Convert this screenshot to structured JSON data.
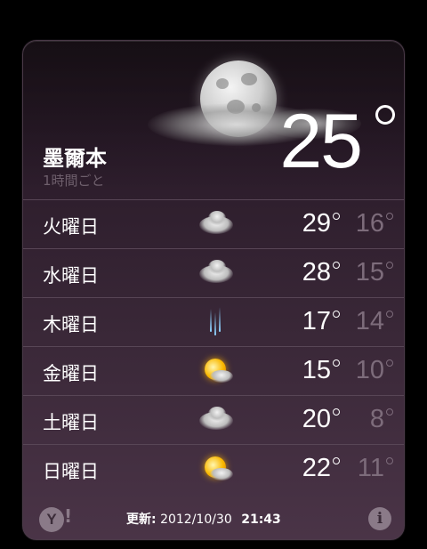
{
  "location": {
    "city": "墨爾本",
    "interval": "1時間ごと"
  },
  "current": {
    "temp": "25"
  },
  "forecast": [
    {
      "day": "火曜日",
      "icon": "partly-cloudy-night-icon",
      "hi": "29",
      "lo": "16"
    },
    {
      "day": "水曜日",
      "icon": "partly-cloudy-night-icon",
      "hi": "28",
      "lo": "15"
    },
    {
      "day": "木曜日",
      "icon": "rain-icon",
      "hi": "17",
      "lo": "14"
    },
    {
      "day": "金曜日",
      "icon": "sun-cloud-icon",
      "hi": "15",
      "lo": "10"
    },
    {
      "day": "土曜日",
      "icon": "partly-cloudy-night-icon",
      "hi": "20",
      "lo": "8"
    },
    {
      "day": "日曜日",
      "icon": "sun-cloud-icon",
      "hi": "22",
      "lo": "11"
    }
  ],
  "footer": {
    "logo": "Y",
    "logo_bang": "!",
    "updated_label": "更新:",
    "updated_date": "2012/10/30",
    "updated_time": "21:43",
    "info_glyph": "i"
  },
  "colors": {
    "card_top": "#21161f",
    "card_bottom": "#4a3447",
    "low_temp": "#7d6c7b"
  }
}
